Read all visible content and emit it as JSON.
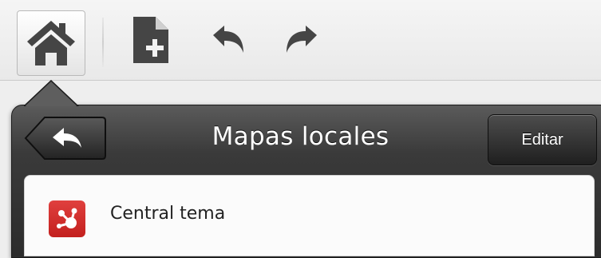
{
  "toolbar": {
    "buttons": [
      {
        "icon": "home-icon"
      },
      {
        "icon": "new-document-icon"
      },
      {
        "icon": "undo-icon"
      },
      {
        "icon": "redo-icon"
      }
    ]
  },
  "popover": {
    "title": "Mapas locales",
    "back_icon": "back-arrow-icon",
    "edit_label": "Editar"
  },
  "list": {
    "items": [
      {
        "label": "Central tema",
        "icon": "mind-map-icon",
        "icon_color": "#d42e2c"
      }
    ]
  },
  "colors": {
    "toolbar_bg": "#eeeeee",
    "popover_header": "#3a3a3a",
    "icon_gray": "#454545"
  }
}
